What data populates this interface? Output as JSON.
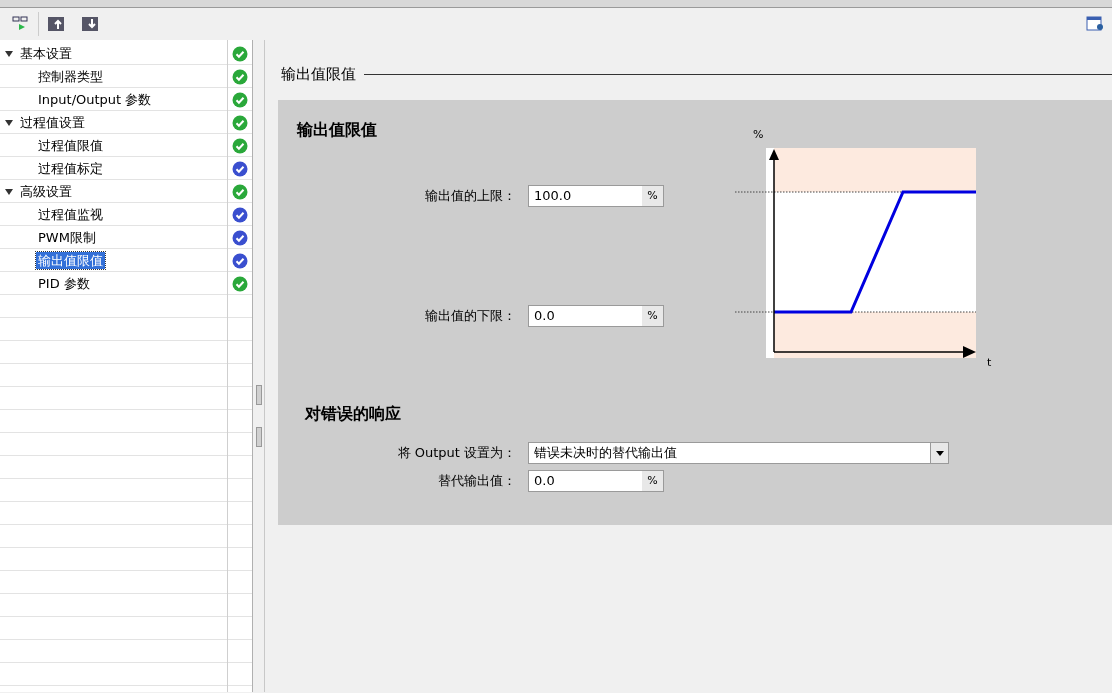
{
  "tree": [
    {
      "label": "基本设置",
      "expanded": true,
      "selected": false,
      "color": "#2aa83a",
      "children": [
        {
          "label": "控制器类型",
          "selected": false,
          "color": "#2aa83a"
        },
        {
          "label": "Input/Output 参数",
          "selected": false,
          "color": "#2aa83a"
        }
      ]
    },
    {
      "label": "过程值设置",
      "expanded": true,
      "selected": false,
      "color": "#2aa83a",
      "children": [
        {
          "label": "过程值限值",
          "selected": false,
          "color": "#2aa83a"
        },
        {
          "label": "过程值标定",
          "selected": false,
          "color": "#3a4fcf"
        }
      ]
    },
    {
      "label": "高级设置",
      "expanded": true,
      "selected": false,
      "color": "#2aa83a",
      "children": [
        {
          "label": "过程值监视",
          "selected": false,
          "color": "#3a4fcf"
        },
        {
          "label": "PWM限制",
          "selected": false,
          "color": "#3a4fcf"
        },
        {
          "label": "输出值限值",
          "selected": true,
          "color": "#3a4fcf"
        },
        {
          "label": "PID 参数",
          "selected": false,
          "color": "#2aa83a"
        }
      ]
    }
  ],
  "section_title": "输出值限值",
  "limits_panel": {
    "title": "输出值限值",
    "fields": [
      {
        "label": "输出值的上限：",
        "value": "100.0",
        "unit": "%"
      },
      {
        "label": "输出值的下限：",
        "value": "0.0",
        "unit": "%"
      }
    ],
    "chart": {
      "y_label": "%",
      "x_label": "t"
    }
  },
  "error_panel": {
    "title": "对错误的响应",
    "output_mode": {
      "label": "将 Output 设置为：",
      "value": "错误未决时的替代输出值"
    },
    "substitute": {
      "label": "替代输出值：",
      "value": "0.0",
      "unit": "%"
    }
  }
}
